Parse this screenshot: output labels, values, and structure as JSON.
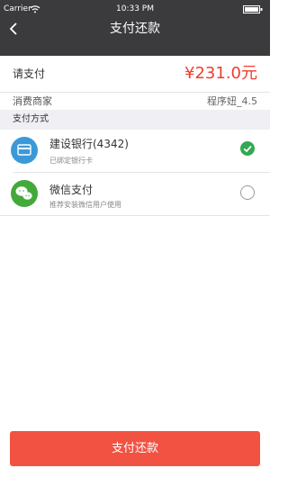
{
  "status_bar": {
    "carrier": "Carrier",
    "time": "10:33 PM"
  },
  "nav": {
    "title": "支付还款",
    "back_icon": "chevron-left-icon"
  },
  "payment": {
    "label": "请支付",
    "amount": "¥231.0元",
    "merchant_label": "消费商家",
    "merchant_value": "程序妞_4.5"
  },
  "methods_section": {
    "title": "支付方式"
  },
  "methods": [
    {
      "name": "建设银行(4342)",
      "subtitle": "已绑定银行卡",
      "icon": "bank-card-icon",
      "icon_color": "#3a9ad9",
      "selected": true
    },
    {
      "name": "微信支付",
      "subtitle": "推荐安装微信用户使用",
      "icon": "wechat-icon",
      "icon_color": "#43a93b",
      "selected": false
    }
  ],
  "footer": {
    "button_label": "支付还款"
  },
  "colors": {
    "nav_background": "#3b3b3d",
    "accent": "#ef3d2d",
    "button": "#f25242",
    "selected": "#34a853"
  }
}
